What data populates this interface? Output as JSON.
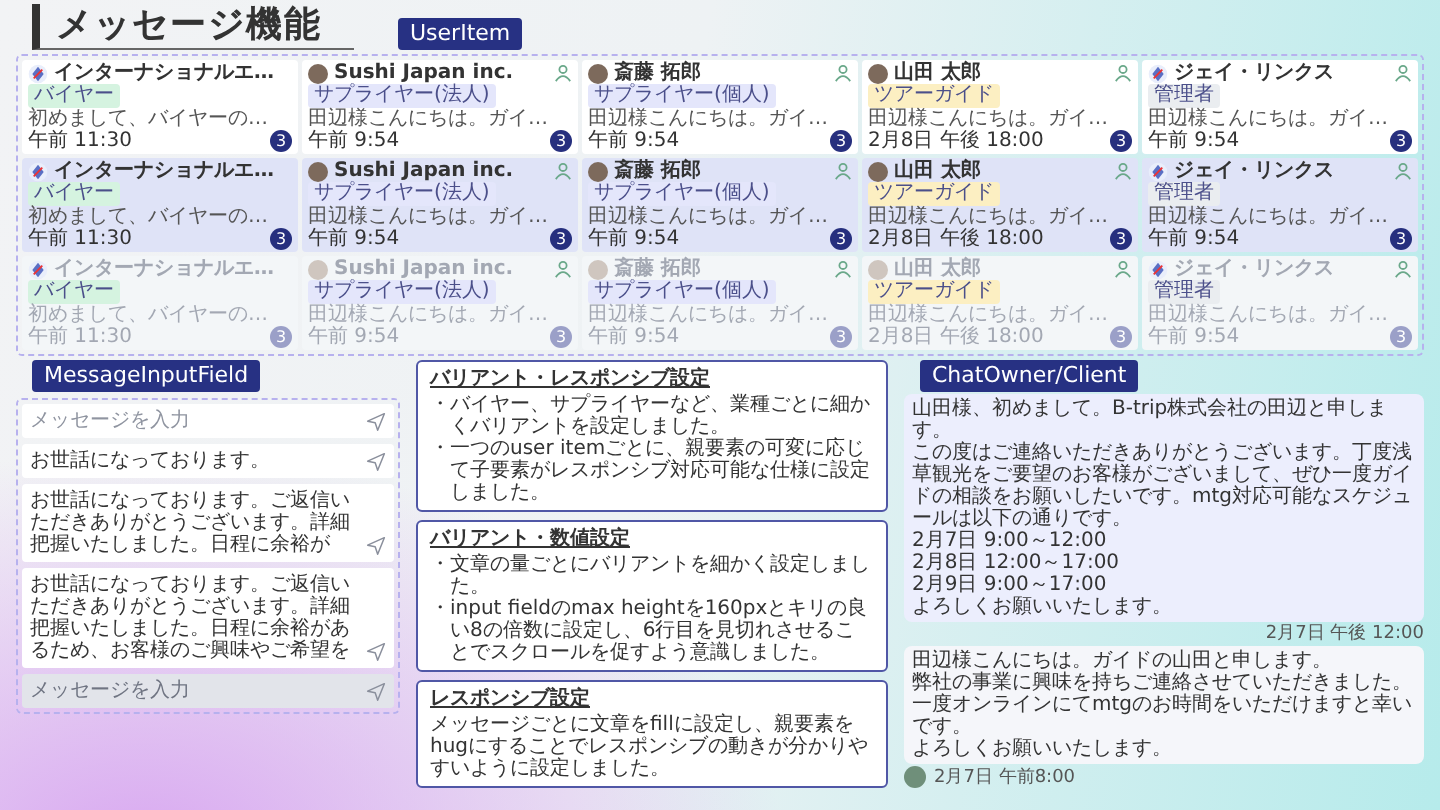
{
  "title": "メッセージ機能",
  "user_item": {
    "label": "UserItem",
    "rows": [
      {
        "hovered": false,
        "disabled": false,
        "items": [
          {
            "kind": "logo",
            "name": "インターナショナルエ…",
            "badge": "バイヤー",
            "color": "#d5f3e0",
            "person": false,
            "time": "午前 11:30",
            "preview": "初めまして、バイヤーの…",
            "count": "3"
          },
          {
            "kind": "photo",
            "name": "Sushi Japan inc.",
            "badge": "サプライヤー(法人)",
            "color": "#e4e6fb",
            "person": true,
            "time": "午前 9:54",
            "preview": "田辺様こんにちは。ガイ…",
            "count": "3"
          },
          {
            "kind": "photo",
            "name": "斎藤 拓郎",
            "badge": "サプライヤー(個人)",
            "color": "#e4e6fb",
            "person": true,
            "time": "午前 9:54",
            "preview": "田辺様こんにちは。ガイ…",
            "count": "3"
          },
          {
            "kind": "photo",
            "name": "山田 太郎",
            "badge": "ツアーガイド",
            "color": "#fcefc2",
            "person": true,
            "time": "2月8日 午後 18:00",
            "preview": "田辺様こんにちは。ガイ…",
            "count": "3"
          },
          {
            "kind": "logo",
            "name": "ジェイ・リンクス",
            "badge": "管理者",
            "color": "#eaedf0",
            "person": true,
            "time": "午前 9:54",
            "preview": "田辺様こんにちは。ガイ…",
            "count": "3"
          }
        ]
      },
      {
        "hovered": true,
        "disabled": false,
        "items": [
          {
            "kind": "logo",
            "name": "インターナショナルエ…",
            "badge": "バイヤー",
            "color": "#d5f3e0",
            "person": false,
            "time": "午前 11:30",
            "preview": "初めまして、バイヤーの…",
            "count": "3"
          },
          {
            "kind": "photo",
            "name": "Sushi Japan inc.",
            "badge": "サプライヤー(法人)",
            "color": "#e4e6fb",
            "person": true,
            "time": "午前 9:54",
            "preview": "田辺様こんにちは。ガイ…",
            "count": "3"
          },
          {
            "kind": "photo",
            "name": "斎藤 拓郎",
            "badge": "サプライヤー(個人)",
            "color": "#e4e6fb",
            "person": true,
            "time": "午前 9:54",
            "preview": "田辺様こんにちは。ガイ…",
            "count": "3"
          },
          {
            "kind": "photo",
            "name": "山田 太郎",
            "badge": "ツアーガイド",
            "color": "#fcefc2",
            "person": true,
            "time": "2月8日 午後 18:00",
            "preview": "田辺様こんにちは。ガイ…",
            "count": "3"
          },
          {
            "kind": "logo",
            "name": "ジェイ・リンクス",
            "badge": "管理者",
            "color": "#eaedf0",
            "person": true,
            "time": "午前 9:54",
            "preview": "田辺様こんにちは。ガイ…",
            "count": "3"
          }
        ]
      },
      {
        "hovered": false,
        "disabled": true,
        "items": [
          {
            "kind": "logo",
            "name": "インターナショナルエ…",
            "badge": "バイヤー",
            "color": "#d5f3e0",
            "person": false,
            "time": "午前 11:30",
            "preview": "初めまして、バイヤーの…",
            "count": "3"
          },
          {
            "kind": "photo",
            "name": "Sushi Japan inc.",
            "badge": "サプライヤー(法人)",
            "color": "#e4e6fb",
            "person": true,
            "time": "午前 9:54",
            "preview": "田辺様こんにちは。ガイ…",
            "count": "3"
          },
          {
            "kind": "photo",
            "name": "斎藤 拓郎",
            "badge": "サプライヤー(個人)",
            "color": "#e4e6fb",
            "person": true,
            "time": "午前 9:54",
            "preview": "田辺様こんにちは。ガイ…",
            "count": "3"
          },
          {
            "kind": "photo",
            "name": "山田 太郎",
            "badge": "ツアーガイド",
            "color": "#fcefc2",
            "person": true,
            "time": "2月8日 午後 18:00",
            "preview": "田辺様こんにちは。ガイ…",
            "count": "3"
          },
          {
            "kind": "logo",
            "name": "ジェイ・リンクス",
            "badge": "管理者",
            "color": "#eaedf0",
            "person": true,
            "time": "午前 9:54",
            "preview": "田辺様こんにちは。ガイ…",
            "count": "3"
          }
        ]
      }
    ]
  },
  "notes": [
    {
      "title": "バリアント・レスポンシブ設定",
      "bullets": [
        "・バイヤー、サプライヤーなど、業種ごとに細かくバリアントを設定しました。",
        "・一つのuser itemごとに、親要素の可変に応じて子要素がレスポンシブ対応可能な仕様に設定しました。"
      ]
    },
    {
      "title": "バリアント・数値設定",
      "bullets": [
        "・文章の量ごとにバリアントを細かく設定しました。",
        "・input fieldのmax heightを160pxとキリの良い8の倍数に設定し、6行目を見切れさせることでスクロールを促すよう意識しました。"
      ]
    },
    {
      "title": "レスポンシブ設定",
      "text": "メッセージごとに文章をfillに設定し、親要素をhugにすることでレスポンシブの動きが分かりやすいように設定しました。"
    }
  ],
  "message_input_field": {
    "label": "MessageInputField",
    "fields": [
      {
        "placeholder": "メッセージを入力",
        "disabled": false
      },
      {
        "value": "お世話になっております。",
        "disabled": false
      },
      {
        "value": "お世話になっております。ご返信いただきありがとうございます。詳細把握いたしました。日程に余裕が",
        "disabled": false
      },
      {
        "value": "お世話になっております。ご返信いただきありがとうございます。詳細把握いたしました。日程に余裕があるため、お客様のご興味やご希望を",
        "disabled": false
      },
      {
        "placeholder": "メッセージを入力",
        "disabled": true
      }
    ]
  },
  "chat": {
    "label": "ChatOwner/Client",
    "messages": [
      {
        "kind": "owner",
        "lines": [
          "山田様、初めまして。B-trip株式会社の田辺と申します。",
          "この度はご連絡いただきありがとうございます。丁度浅草観光をご要望のお客様がございまして、ぜひ一度ガイドの相談をお願いしたいです。mtg対応可能なスケジュールは以下の通りです。",
          "2月7日 9:00～12:00",
          "2月8日 12:00～17:00",
          "2月9日 9:00～17:00",
          "よろしくお願いいたします。"
        ],
        "time": "2月7日 午後 12:00"
      },
      {
        "kind": "client",
        "lines": [
          "田辺様こんにちは。ガイドの山田と申します。",
          "弊社の事業に興味を持ちご連絡させていただきました。",
          "一度オンラインにてmtgのお時間をいただけますと幸いです。",
          "よろしくお願いいたします。"
        ],
        "time": "2月7日 午前8:00"
      }
    ]
  }
}
